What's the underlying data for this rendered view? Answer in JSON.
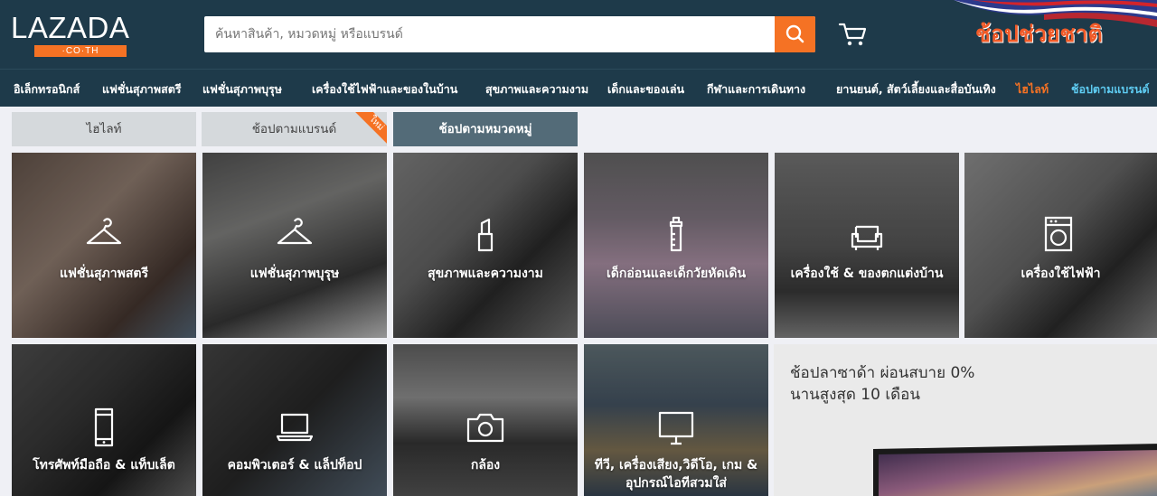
{
  "logo": {
    "word": "LAZADA",
    "sub": "·CO·TH"
  },
  "search": {
    "placeholder": "ค้นหาสินค้า, หมวดหมู่ หรือแบรนด์"
  },
  "promo": {
    "text": "ช้อปช่วยชาติ"
  },
  "catnav": [
    "อิเล็กทรอนิกส์",
    "แฟชั่นสุภาพสตรี",
    "แฟชั่นสุภาพบุรุษ",
    "เครื่องใช้ไฟฟ้าและของในบ้าน",
    "สุขภาพและความงาม",
    "เด็กและของเล่น",
    "กีฬาและการเดินทาง",
    "ยานยนต์, สัตว์เลี้ยงและสื่อบันเทิง",
    "ไฮไลท์",
    "ช้อปตามแบรนด์"
  ],
  "tabs": {
    "highlight": "ไฮไลท์",
    "brand": "ช้อปตามแบรนด์",
    "new_badge": "ใหม่",
    "category": "ช้อปตามหมวดหมู่"
  },
  "tiles": [
    {
      "label": "แฟชั่นสุภาพสตรี"
    },
    {
      "label": "แฟชั่นสุภาพบุรุษ"
    },
    {
      "label": "สุขภาพและความงาม"
    },
    {
      "label": "เด็กอ่อนและเด็กวัยหัดเดิน"
    },
    {
      "label": "เครื่องใช้ & ของตกแต่งบ้าน"
    },
    {
      "label": "เครื่องใช้ไฟฟ้า"
    },
    {
      "label": "โทรศัพท์มือถือ & แท็บเล็ต"
    },
    {
      "label": "คอมพิวเตอร์ & แล็ปท็อป"
    },
    {
      "label": "กล้อง"
    },
    {
      "label": "ทีวี, เครื่องเสียง,วิดีโอ, เกม &",
      "label2": "อุปกรณ์ไอทีสวมใส่"
    }
  ],
  "promo_tile": {
    "line1": "ช้อปลาซาด้า ผ่อนสบาย 0%",
    "line2": "นานสูงสุด 10 เดือน"
  },
  "colors": {
    "header": "#1e3a4a",
    "accent": "#f57224",
    "tab_active": "#536b78",
    "brand_link": "#5ecbf1"
  }
}
